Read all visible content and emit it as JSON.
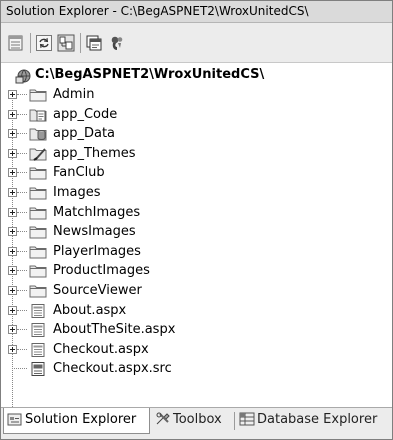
{
  "window": {
    "title": "Solution Explorer - C:\\BegASPNET2\\WroxUnitedCS\\"
  },
  "toolbar": {
    "buttons": [
      "properties-icon",
      "refresh-icon",
      "nest-related-files-icon",
      "view-code-icon",
      "copy-web-site-icon"
    ]
  },
  "tree": {
    "root": "C:\\BegASPNET2\\WroxUnitedCS\\",
    "items": [
      {
        "label": "Admin",
        "icon": "folder-icon"
      },
      {
        "label": "app_Code",
        "icon": "code-folder-icon"
      },
      {
        "label": "app_Data",
        "icon": "data-folder-icon"
      },
      {
        "label": "app_Themes",
        "icon": "themes-folder-icon"
      },
      {
        "label": "FanClub",
        "icon": "folder-icon"
      },
      {
        "label": "Images",
        "icon": "folder-icon"
      },
      {
        "label": "MatchImages",
        "icon": "folder-icon"
      },
      {
        "label": "NewsImages",
        "icon": "folder-icon"
      },
      {
        "label": "PlayerImages",
        "icon": "folder-icon"
      },
      {
        "label": "ProductImages",
        "icon": "folder-icon"
      },
      {
        "label": "SourceViewer",
        "icon": "folder-icon"
      },
      {
        "label": "About.aspx",
        "icon": "aspx-file-icon"
      },
      {
        "label": "AboutTheSite.aspx",
        "icon": "aspx-file-icon"
      },
      {
        "label": "Checkout.aspx",
        "icon": "aspx-file-icon"
      },
      {
        "label": "Checkout.aspx.src",
        "icon": "src-file-icon"
      }
    ]
  },
  "tabs": [
    {
      "label": "Solution Explorer",
      "active": true
    },
    {
      "label": "Toolbox",
      "active": false
    },
    {
      "label": "Database Explorer",
      "active": false
    }
  ]
}
